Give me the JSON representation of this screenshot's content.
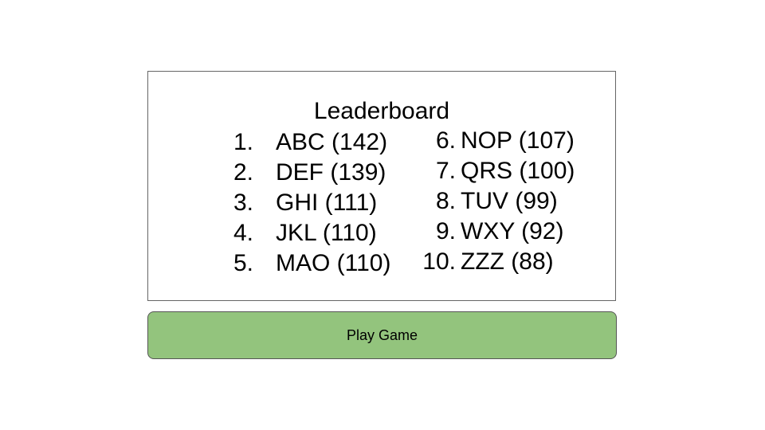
{
  "leaderboard": {
    "title": "Leaderboard",
    "left_column": [
      {
        "rank": "1.",
        "entry": "ABC (142)"
      },
      {
        "rank": "2.",
        "entry": "DEF (139)"
      },
      {
        "rank": "3.",
        "entry": "GHI (111)"
      },
      {
        "rank": "4.",
        "entry": "JKL (110)"
      },
      {
        "rank": "5.",
        "entry": "MAO (110)"
      }
    ],
    "right_column": [
      {
        "rank": "6.",
        "entry": "NOP (107)"
      },
      {
        "rank": "7.",
        "entry": "QRS (100)"
      },
      {
        "rank": "8.",
        "entry": "TUV (99)"
      },
      {
        "rank": "9.",
        "entry": "WXY (92)"
      },
      {
        "rank": "10.",
        "entry": "ZZZ (88)"
      }
    ]
  },
  "play_button": {
    "label": "Play Game"
  },
  "colors": {
    "button_fill": "#93c47d",
    "board_border": "#666666"
  }
}
